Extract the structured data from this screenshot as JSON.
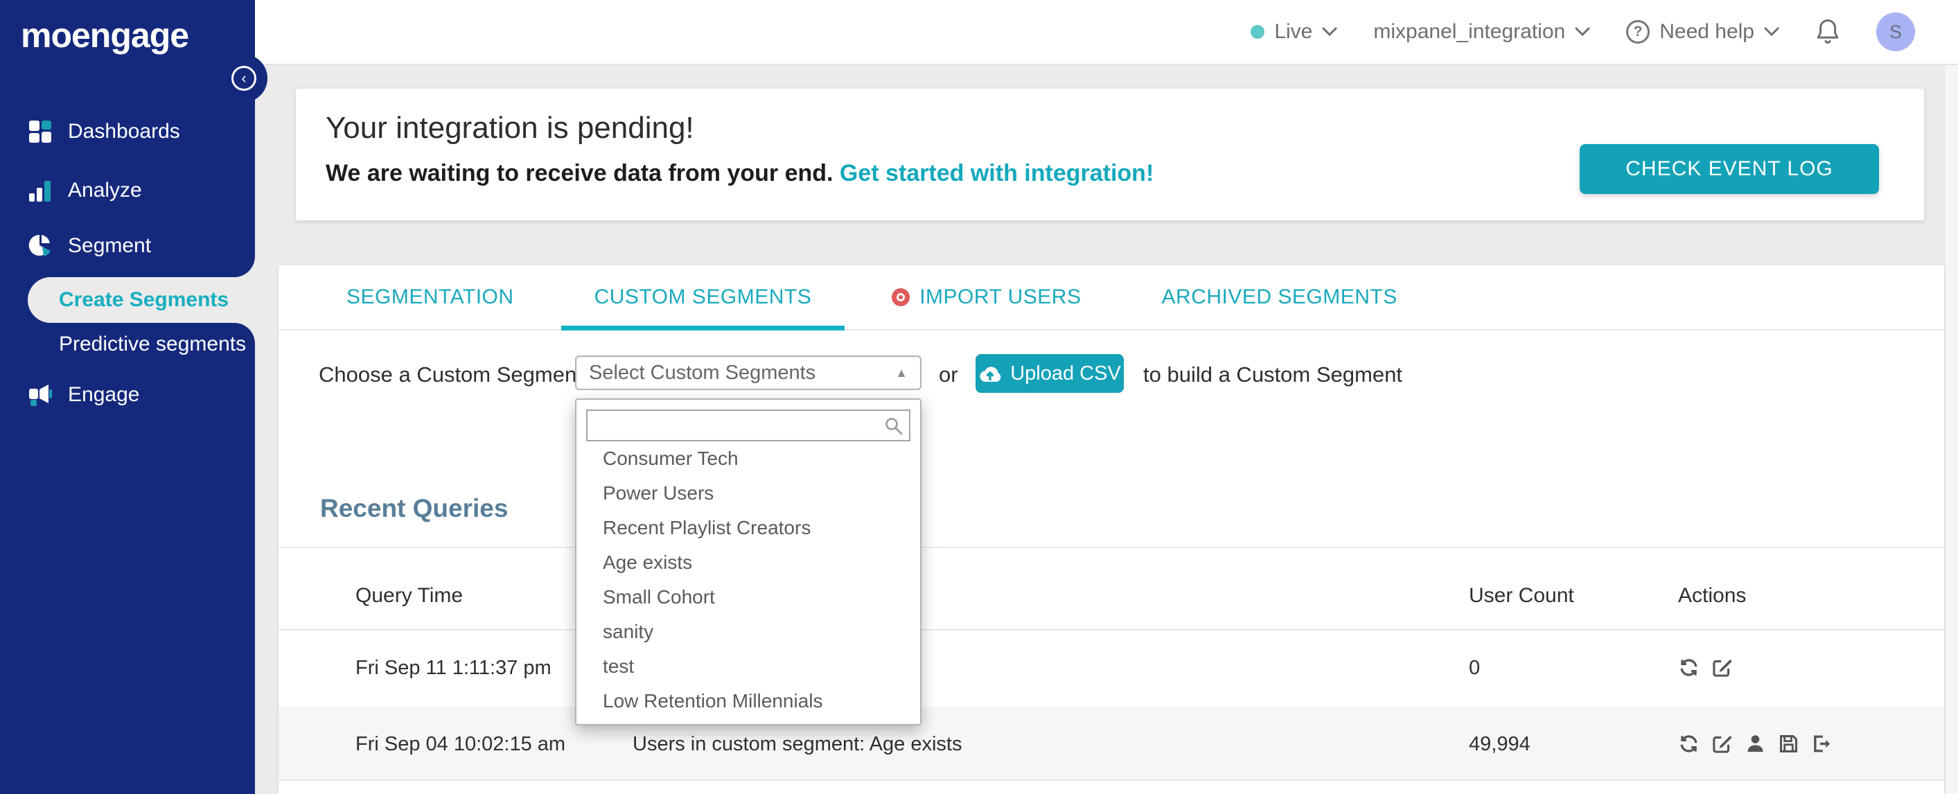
{
  "colors": {
    "navy": "#15297c",
    "teal": "#14a2b8",
    "teal_text": "#19a9bd",
    "page_bg": "#ebebeb",
    "heading_slate": "#587e99",
    "import_dot": "#e05b5b",
    "avatar_bg": "#a9b3f3",
    "live_dot": "#5fc9c9"
  },
  "topbar": {
    "live_label": "Live",
    "workspace": "mixpanel_integration",
    "help_label": "Need help",
    "avatar_initial": "S"
  },
  "icons": {
    "question": "?",
    "caret_up": "▲",
    "collapse_chevron": "‹"
  },
  "sidebar": {
    "logo": "moengage",
    "items": [
      {
        "label": "Dashboards"
      },
      {
        "label": "Analyze"
      },
      {
        "label": "Segment"
      },
      {
        "label": "Engage"
      }
    ],
    "segment_children": [
      {
        "label": "Create Segments",
        "active": true
      },
      {
        "label": "Predictive segments",
        "active": false
      }
    ]
  },
  "banner": {
    "title": "Your integration is pending!",
    "subtitle": "We are waiting to receive data from your end.",
    "link": "Get started with integration!",
    "button": "CHECK EVENT LOG"
  },
  "tabs": [
    {
      "label": "SEGMENTATION"
    },
    {
      "label": "CUSTOM SEGMENTS",
      "active": true
    },
    {
      "label": "IMPORT USERS",
      "dot": true
    },
    {
      "label": "ARCHIVED SEGMENTS"
    }
  ],
  "segment_picker": {
    "label": "Choose a Custom Segment:",
    "select_value": "Select Custom Segments",
    "or_text": "or",
    "upload_button": "Upload CSV",
    "suffix": "to build a Custom Segment",
    "search_value": "",
    "options": [
      "Consumer Tech",
      "Power Users",
      "Recent Playlist Creators",
      "Age exists",
      "Small Cohort",
      "sanity",
      "test",
      "Low Retention Millennials"
    ]
  },
  "recent_queries": {
    "title": "Recent Queries",
    "columns": {
      "time": "Query Time",
      "count": "User Count",
      "actions": "Actions"
    },
    "rows": [
      {
        "time": "Fri Sep 11 1:11:37 pm",
        "query": "",
        "count": "0"
      },
      {
        "time": "Fri Sep 04 10:02:15 am",
        "query": "Users in custom segment: Age exists",
        "count": "49,994"
      }
    ]
  }
}
